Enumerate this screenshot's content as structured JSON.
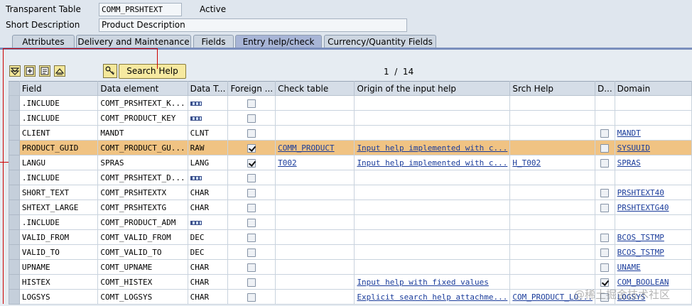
{
  "header": {
    "table_label": "Transparent Table",
    "table_name": "COMM_PRSHTEXT",
    "status": "Active",
    "desc_label": "Short Description",
    "desc_value": "Product Description"
  },
  "tabs": [
    {
      "label": "Attributes",
      "active": false
    },
    {
      "label": "Delivery and Maintenance",
      "active": false
    },
    {
      "label": "Fields",
      "active": false
    },
    {
      "label": "Entry help/check",
      "active": true
    },
    {
      "label": "Currency/Quantity Fields",
      "active": false
    }
  ],
  "toolbar": {
    "search_help_label": "Search Help",
    "pager": "1  /  14",
    "icons": [
      "select-all-icon",
      "new-entries-icon",
      "detail-icon",
      "top-icon",
      "key-icon"
    ]
  },
  "table": {
    "columns": [
      "Field",
      "Data element",
      "Data T...",
      "Foreign ...",
      "Check table",
      "Origin of the input help",
      "Srch Help",
      "D...",
      "Domain"
    ],
    "rows": [
      {
        "field": ".INCLUDE",
        "data_element": "COMT_PRSHTEXT_K...",
        "type": "",
        "struct": true,
        "foreign": false,
        "check_table": "",
        "origin": "",
        "srch_help": "",
        "d": null,
        "domain": ""
      },
      {
        "field": ".INCLUDE",
        "data_element": "COMT_PRODUCT_KEY",
        "type": "",
        "struct": true,
        "foreign": false,
        "check_table": "",
        "origin": "",
        "srch_help": "",
        "d": null,
        "domain": ""
      },
      {
        "field": "CLIENT",
        "data_element": "MANDT",
        "type": "CLNT",
        "struct": false,
        "foreign": false,
        "check_table": "",
        "origin": "",
        "srch_help": "",
        "d": false,
        "domain": "MANDT"
      },
      {
        "field": "PRODUCT_GUID",
        "data_element": "COMT_PRODUCT_GU...",
        "type": "RAW",
        "struct": false,
        "foreign": true,
        "check_table": "COMM_PRODUCT",
        "origin": "Input help implemented with c...",
        "srch_help": "",
        "d": false,
        "domain": "SYSUUID",
        "highlight": true
      },
      {
        "field": "LANGU",
        "data_element": "SPRAS",
        "type": "LANG",
        "struct": false,
        "foreign": true,
        "check_table": "T002",
        "origin": "Input help implemented with c...",
        "srch_help": "H_T002",
        "d": false,
        "domain": "SPRAS"
      },
      {
        "field": ".INCLUDE",
        "data_element": "COMT_PRSHTEXT_D...",
        "type": "",
        "struct": true,
        "foreign": false,
        "check_table": "",
        "origin": "",
        "srch_help": "",
        "d": null,
        "domain": ""
      },
      {
        "field": "SHORT_TEXT",
        "data_element": "COMT_PRSHTEXTX",
        "type": "CHAR",
        "struct": false,
        "foreign": false,
        "check_table": "",
        "origin": "",
        "srch_help": "",
        "d": false,
        "domain": "PRSHTEXT40"
      },
      {
        "field": "SHTEXT_LARGE",
        "data_element": "COMT_PRSHTEXTG",
        "type": "CHAR",
        "struct": false,
        "foreign": false,
        "check_table": "",
        "origin": "",
        "srch_help": "",
        "d": false,
        "domain": "PRSHTEXTG40"
      },
      {
        "field": ".INCLUDE",
        "data_element": "COMT_PRODUCT_ADM",
        "type": "",
        "struct": true,
        "foreign": false,
        "check_table": "",
        "origin": "",
        "srch_help": "",
        "d": null,
        "domain": ""
      },
      {
        "field": "VALID_FROM",
        "data_element": "COMT_VALID_FROM",
        "type": "DEC",
        "struct": false,
        "foreign": false,
        "check_table": "",
        "origin": "",
        "srch_help": "",
        "d": false,
        "domain": "BCOS_TSTMP"
      },
      {
        "field": "VALID_TO",
        "data_element": "COMT_VALID_TO",
        "type": "DEC",
        "struct": false,
        "foreign": false,
        "check_table": "",
        "origin": "",
        "srch_help": "",
        "d": false,
        "domain": "BCOS_TSTMP"
      },
      {
        "field": "UPNAME",
        "data_element": "COMT_UPNAME",
        "type": "CHAR",
        "struct": false,
        "foreign": false,
        "check_table": "",
        "origin": "",
        "srch_help": "",
        "d": false,
        "domain": "UNAME"
      },
      {
        "field": "HISTEX",
        "data_element": "COMT_HISTEX",
        "type": "CHAR",
        "struct": false,
        "foreign": false,
        "check_table": "",
        "origin": "Input help with fixed values",
        "srch_help": "",
        "d": true,
        "domain": "COM_BOOLEAN"
      },
      {
        "field": "LOGSYS",
        "data_element": "COMT_LOGSYS",
        "type": "CHAR",
        "struct": false,
        "foreign": false,
        "check_table": "",
        "origin": "Explicit search help attachme...",
        "srch_help": "COM_PRODUCT_LO...",
        "d": false,
        "domain": "LOGSYS"
      }
    ]
  },
  "watermark": "@稀土掘金技术社区"
}
